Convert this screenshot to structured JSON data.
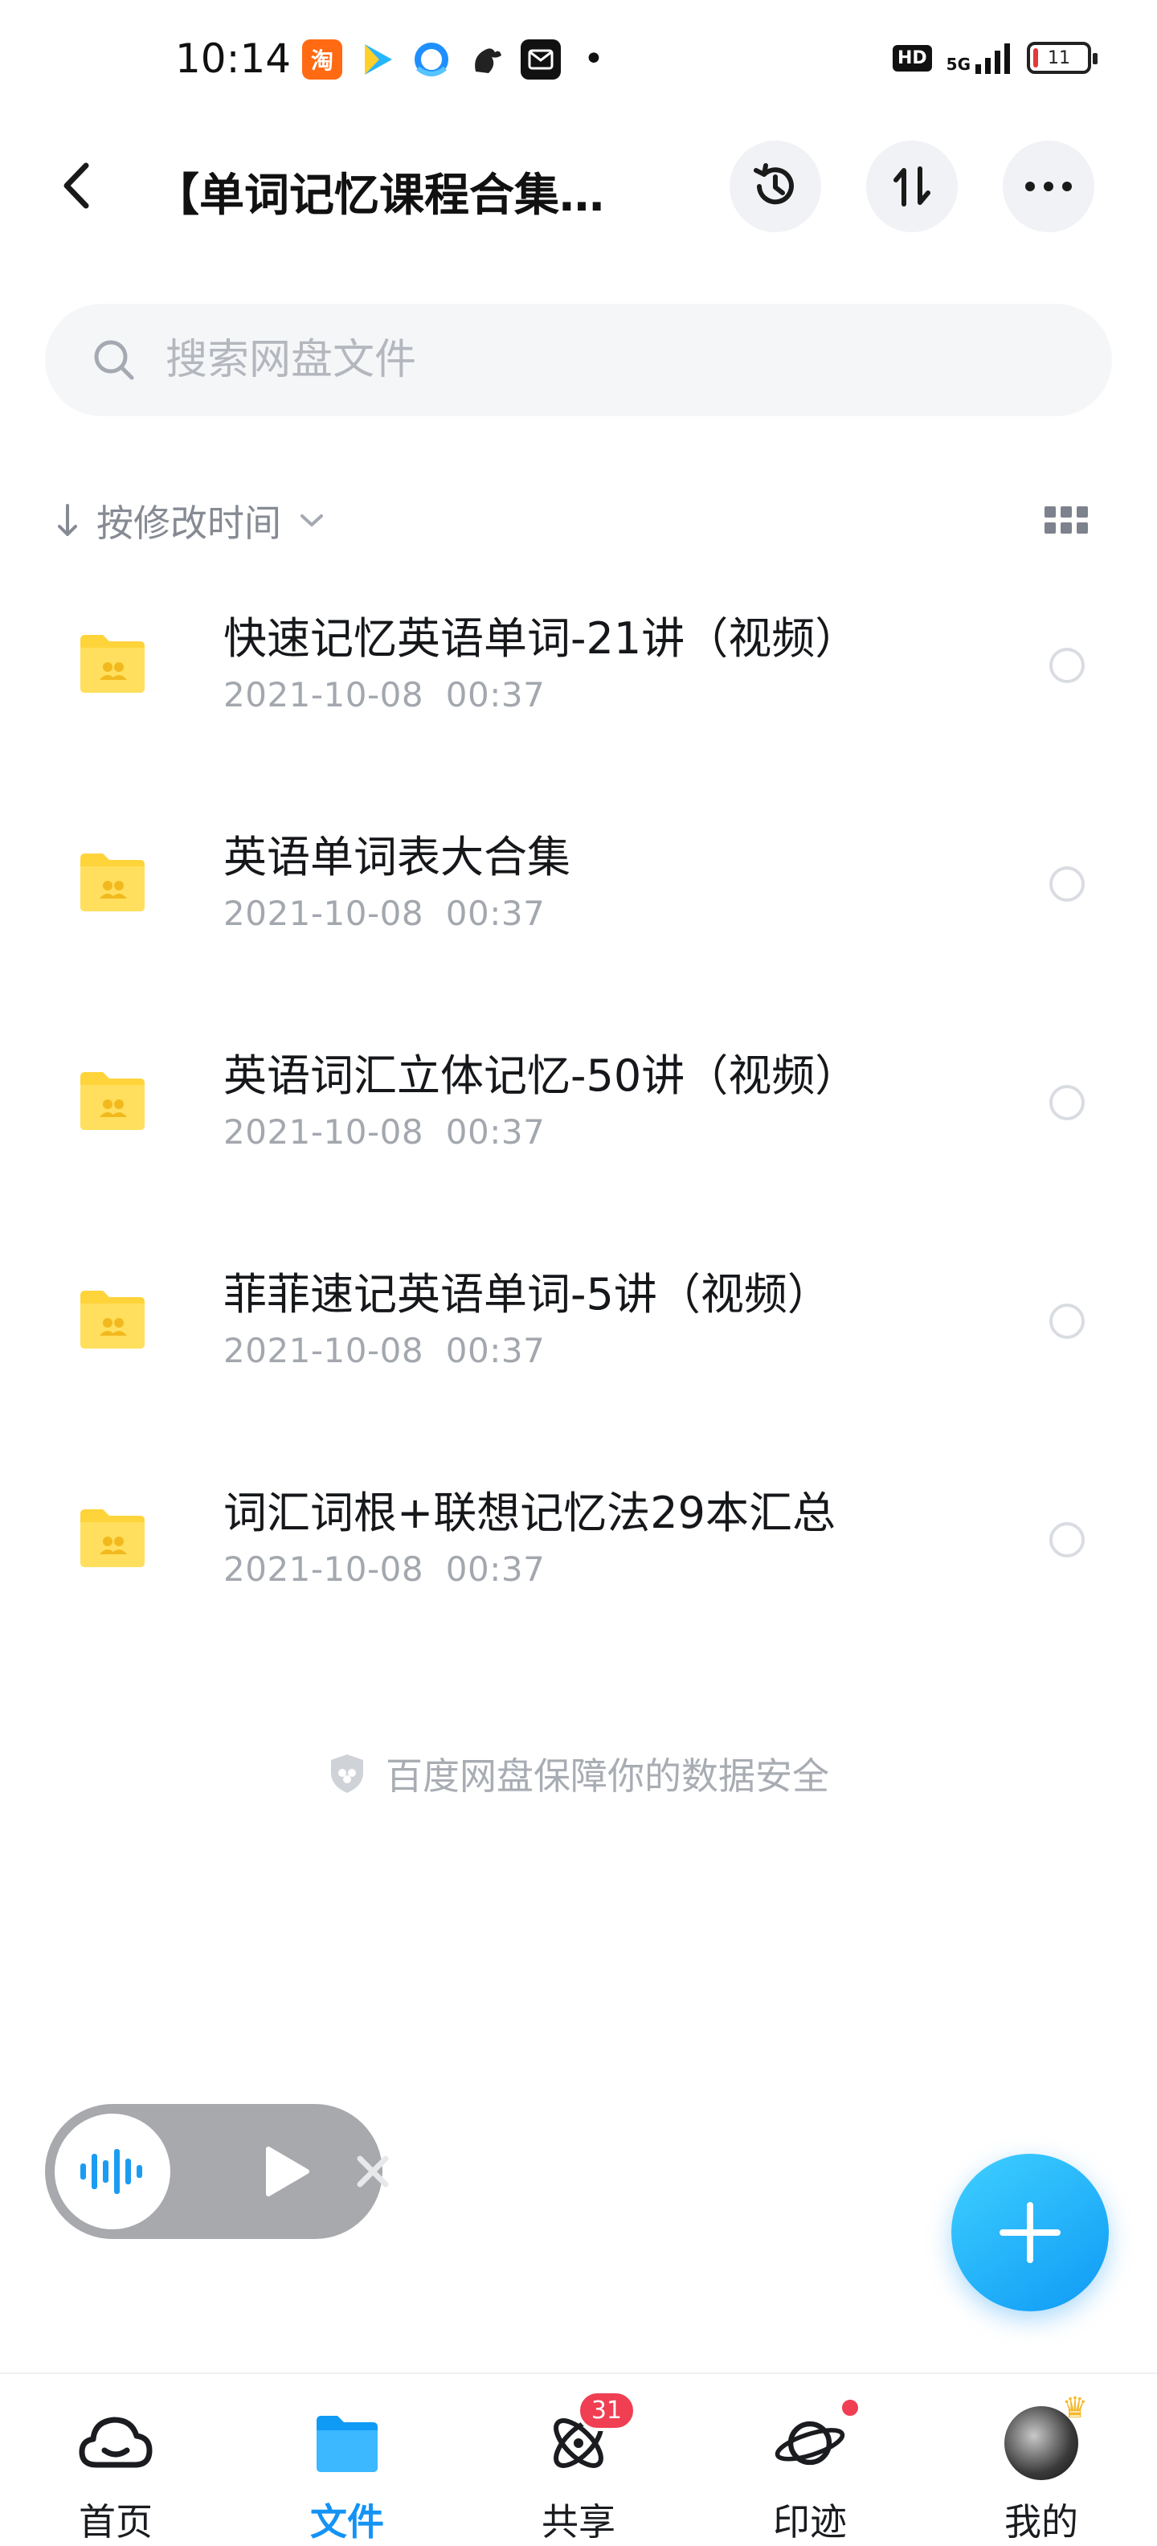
{
  "status_bar": {
    "time": "10:14",
    "apps": [
      {
        "icon": "taobao-icon",
        "glyph": "淘",
        "color": "#ff6a13"
      },
      {
        "icon": "tencent-video-icon",
        "glyph": "▶",
        "color": "#2bb6ff"
      },
      {
        "icon": "browser-icon",
        "glyph": "◐",
        "color": "#1a8cff"
      },
      {
        "icon": "uc-squirrel-icon",
        "glyph": "✿",
        "color": "#222222"
      },
      {
        "icon": "mail-icon",
        "glyph": "✉",
        "color": "#111111"
      }
    ],
    "dot": "•",
    "hd": "HD",
    "network": "5G",
    "battery": "11"
  },
  "header": {
    "title": "【单词记忆课程合集…",
    "back_icon": "back-arrow-icon",
    "history_icon": "history-icon",
    "transfer_icon": "transfer-icon",
    "more_icon": "more-icon"
  },
  "search": {
    "placeholder": "搜索网盘文件"
  },
  "sort": {
    "label": "按修改时间",
    "arrow": "↓",
    "chevron": "⌄"
  },
  "files": [
    {
      "name": "快速记忆英语单词-21讲（视频）",
      "date": "2021-10-08  00:37"
    },
    {
      "name": "英语单词表大合集",
      "date": "2021-10-08  00:37"
    },
    {
      "name": "英语词汇立体记忆-50讲（视频）",
      "date": "2021-10-08  00:37"
    },
    {
      "name": "菲菲速记英语单词-5讲（视频）",
      "date": "2021-10-08  00:37"
    },
    {
      "name": "词汇词根+联想记忆法29本汇总",
      "date": "2021-10-08  00:37"
    }
  ],
  "footer_note": "百度网盘保障你的数据安全",
  "colors": {
    "accent": "#1493f5",
    "folder": "#ffd43b",
    "badge": "#f03e52"
  },
  "nav": {
    "items": [
      {
        "label": "首页",
        "icon": "home-cloud-icon"
      },
      {
        "label": "文件",
        "icon": "folder-icon"
      },
      {
        "label": "共享",
        "icon": "share-atom-icon",
        "badge": "31"
      },
      {
        "label": "印迹",
        "icon": "planet-icon"
      },
      {
        "label": "我的",
        "icon": "avatar"
      }
    ]
  }
}
